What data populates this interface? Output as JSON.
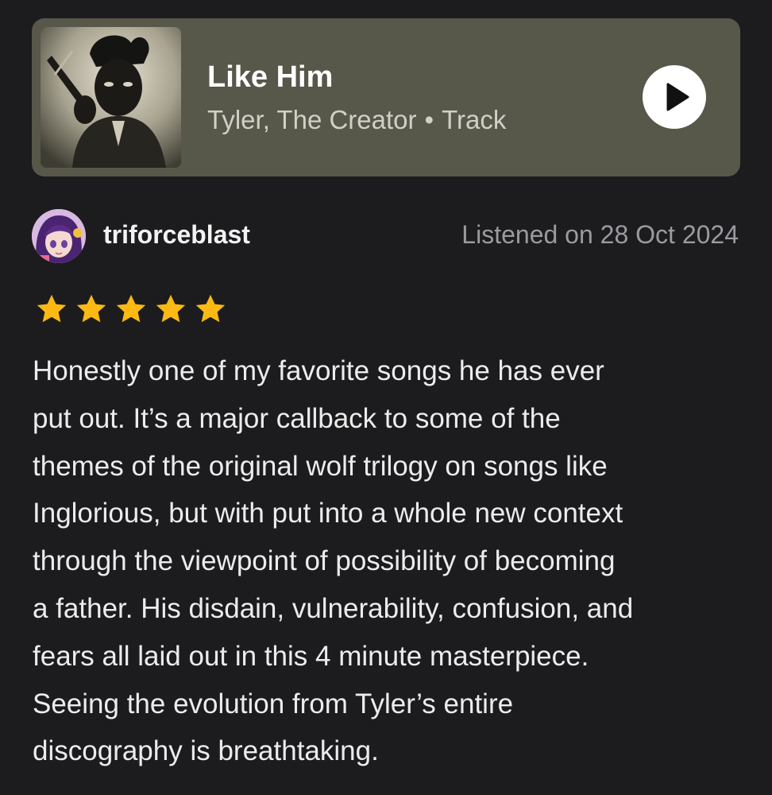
{
  "track": {
    "title": "Like Him",
    "artist": "Tyler, The Creator",
    "separator": "•",
    "type": "Track",
    "card_color": "#57574a",
    "cover_icon": "album-cover-image",
    "play_icon": "play-icon"
  },
  "review": {
    "username": "triforceblast",
    "avatar_icon": "user-avatar-image",
    "listened_label": "Listened on 28 Oct 2024",
    "rating": 5,
    "rating_max": 5,
    "star_color": "#fdb913",
    "body_lines": [
      "Honestly one of my favorite songs he has ever",
      "put out. It’s a major callback to some of the",
      "themes of the original wolf trilogy on songs like",
      "Inglorious, but with put into a whole new context",
      "through the viewpoint of possibility of becoming",
      "a father. His disdain, vulnerability, confusion, and",
      "fears all laid out in this 4 minute masterpiece.",
      "Seeing the evolution from Tyler’s entire",
      "discography is breathtaking."
    ]
  }
}
